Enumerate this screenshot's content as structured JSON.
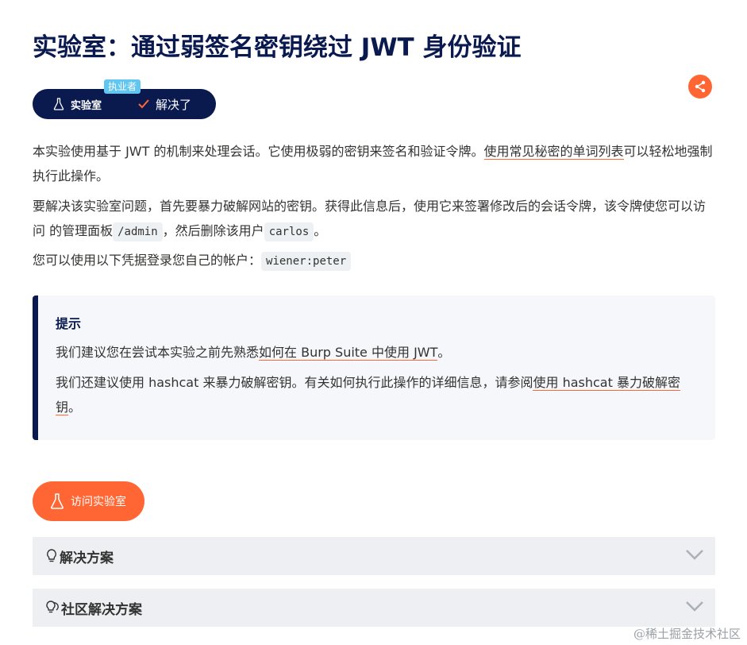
{
  "page_title": "实验室：通过弱签名密钥绕过 JWT 身份验证",
  "level_tag": "执业者",
  "status_pill": {
    "lab_label": "实验室",
    "solved_label": "解决了"
  },
  "intro": {
    "p1_text": "本实验使用基于 JWT 的机制来处理会话。它使用极弱的密钥来签名和验证令牌。",
    "p1_link": "使用常见秘密的单词列表",
    "p1_tail": "可以轻松地强制执行此操作。",
    "p2_text": "要解决该实验室问题，首先要暴力破解网站的密钥。获得此信息后，使用它来签署修改后的会话令牌，该令牌使您可以访问 的管理面板",
    "p2_code1": "/admin",
    "p2_mid": "，然后删除该用户",
    "p2_code2": "carlos",
    "p2_end": "。",
    "p3_text": "您可以使用以下凭据登录您自己的帐户：",
    "p3_code": "wiener:peter"
  },
  "hint": {
    "title": "提示",
    "p1_text": "我们建议您在尝试本实验之前先熟悉",
    "p1_link": "如何在 Burp Suite 中使用 JWT",
    "p1_end": "。",
    "p2_text": "我们还建议使用 hashcat 来暴力破解密钥。有关如何执行此操作的详细信息，请参阅",
    "p2_link": "使用 hashcat 暴力破解密钥",
    "p2_end": "。"
  },
  "access_button_label": "访问实验室",
  "accordions": [
    {
      "label": "解决方案"
    },
    {
      "label": "社区解决方案"
    }
  ],
  "watermark": "@稀土掘金技术社区",
  "colors": {
    "navy": "#0a1a4f",
    "orange": "#ff6633",
    "tag_blue": "#61c6f0"
  }
}
